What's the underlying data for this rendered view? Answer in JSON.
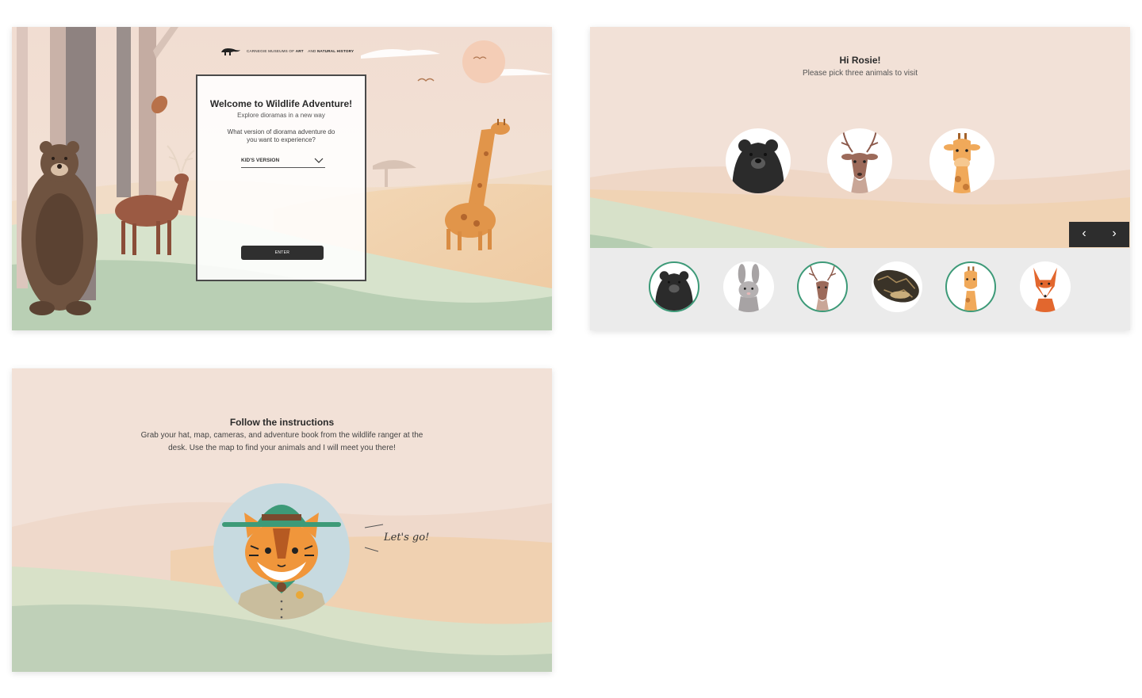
{
  "welcome_screen": {
    "logo_text_prefix": "CARNEGIE MUSEUMS OF",
    "logo_text_art": "ART",
    "logo_text_and": "AND",
    "logo_text_nh": "NATURAL HISTORY",
    "title": "Welcome to Wildlife Adventure!",
    "subtitle": "Explore dioramas in a new way",
    "question": "What version of diorama adventure do you want to experience?",
    "version_selected": "KID'S VERSION",
    "enter_label": "ENTER"
  },
  "pick_screen": {
    "greeting": "Hi Rosie!",
    "instruction": "Please pick three animals to visit",
    "selected_animals": [
      "bear",
      "deer",
      "giraffe"
    ],
    "animals": [
      {
        "name": "bear",
        "selected": true
      },
      {
        "name": "rabbit",
        "selected": false
      },
      {
        "name": "deer",
        "selected": true
      },
      {
        "name": "snake",
        "selected": false
      },
      {
        "name": "giraffe",
        "selected": true
      },
      {
        "name": "fox",
        "selected": false
      }
    ],
    "prev_icon": "chevron-left-icon",
    "next_icon": "chevron-right-icon",
    "prev_glyph": "‹",
    "next_glyph": "›"
  },
  "instructions_screen": {
    "title": "Follow the instructions",
    "body": "Grab your hat, map, cameras, and adventure book from the wildlife ranger at the desk. Use the map to find your animals and I will meet you there!",
    "speech": "Let's go!"
  },
  "colors": {
    "accent_green": "#3d9a78",
    "dark_button": "#2f2f2f",
    "sky": "#f3e2d8"
  }
}
